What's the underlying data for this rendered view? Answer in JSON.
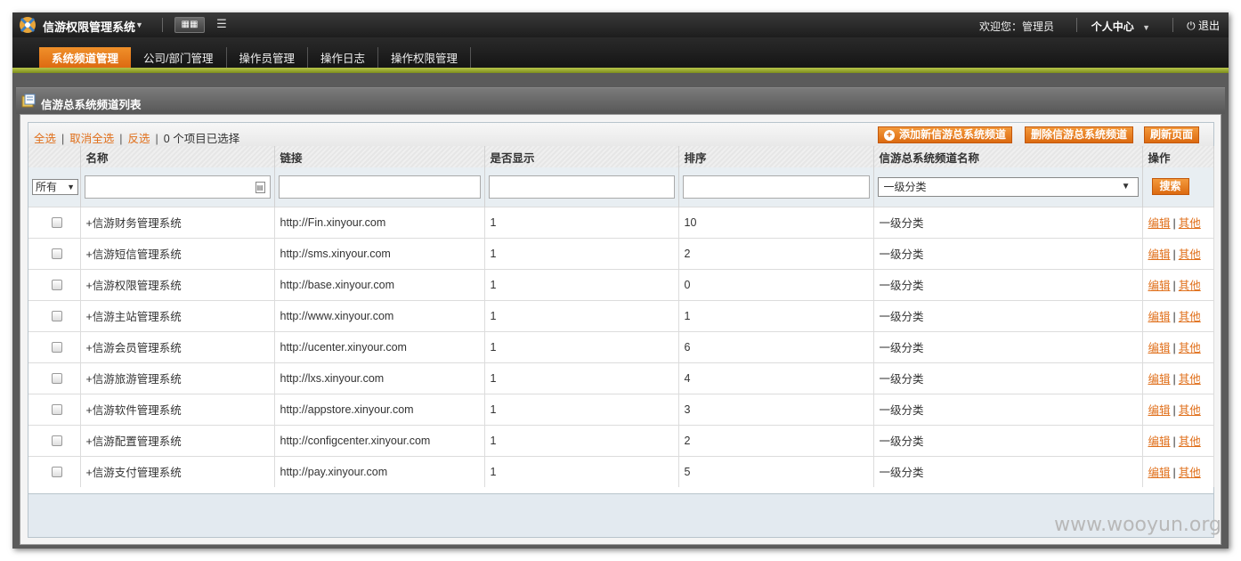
{
  "header": {
    "app_title": "信游权限管理系统",
    "welcome": "欢迎您：管理员",
    "personal_center": "个人中心",
    "logout": "退出"
  },
  "nav": {
    "items": [
      {
        "label": "系统频道管理",
        "active": true
      },
      {
        "label": "公司/部门管理",
        "active": false
      },
      {
        "label": "操作员管理",
        "active": false
      },
      {
        "label": "操作日志",
        "active": false
      },
      {
        "label": "操作权限管理",
        "active": false
      }
    ]
  },
  "panel": {
    "title": "信游总系统频道列表"
  },
  "selection": {
    "select_all": "全选",
    "cancel_all": "取消全选",
    "invert": "反选",
    "count": "0 个项目已选择"
  },
  "actions": {
    "add": "添加新信游总系统频道",
    "delete": "删除信游总系统频道",
    "refresh": "刷新页面"
  },
  "table": {
    "columns": [
      "名称",
      "链接",
      "是否显示",
      "排序",
      "信游总系统频道名称",
      "操作"
    ],
    "filter_all": "所有",
    "filter_category": "一级分类",
    "search": "搜索",
    "edit": "编辑",
    "other": "其他",
    "rows": [
      {
        "name": "+信游财务管理系统",
        "link": "http://Fin.xinyour.com",
        "show": "1",
        "sort": "10",
        "category": "一级分类"
      },
      {
        "name": "+信游短信管理系统",
        "link": "http://sms.xinyour.com",
        "show": "1",
        "sort": "2",
        "category": "一级分类"
      },
      {
        "name": "+信游权限管理系统",
        "link": "http://base.xinyour.com",
        "show": "1",
        "sort": "0",
        "category": "一级分类"
      },
      {
        "name": "+信游主站管理系统",
        "link": "http://www.xinyour.com",
        "show": "1",
        "sort": "1",
        "category": "一级分类"
      },
      {
        "name": "+信游会员管理系统",
        "link": "http://ucenter.xinyour.com",
        "show": "1",
        "sort": "6",
        "category": "一级分类"
      },
      {
        "name": "+信游旅游管理系统",
        "link": "http://lxs.xinyour.com",
        "show": "1",
        "sort": "4",
        "category": "一级分类"
      },
      {
        "name": "+信游软件管理系统",
        "link": "http://appstore.xinyour.com",
        "show": "1",
        "sort": "3",
        "category": "一级分类"
      },
      {
        "name": "+信游配置管理系统",
        "link": "http://configcenter.xinyour.com",
        "show": "1",
        "sort": "2",
        "category": "一级分类"
      },
      {
        "name": "+信游支付管理系统",
        "link": "http://pay.xinyour.com",
        "show": "1",
        "sort": "5",
        "category": "一级分类"
      }
    ]
  },
  "watermark": "www.wooyun.org",
  "colors": {
    "accent": "#dc6a10",
    "link": "#e0701c",
    "nav_stripe": "#9aaa2c"
  }
}
